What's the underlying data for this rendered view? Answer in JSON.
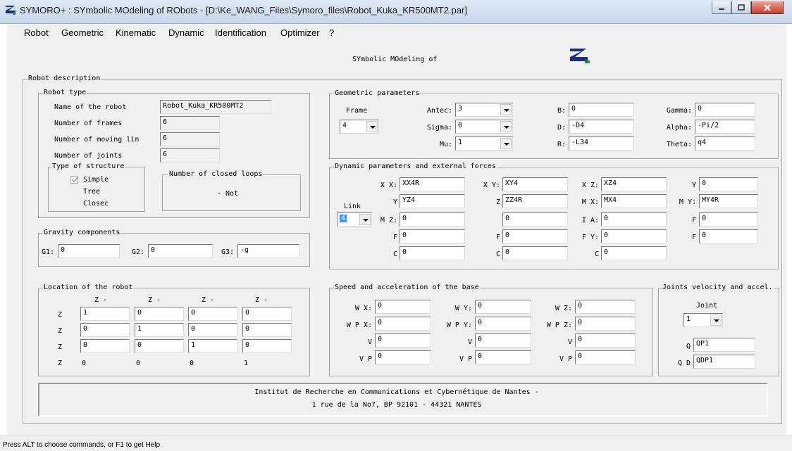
{
  "window": {
    "title": "SYMORO+ : SYmbolic MOdeling of RObots - [D:\\Ke_WANG_Files\\Symoro_files\\Robot_Kuka_KR500MT2.par]",
    "controls": {
      "minimize": "minimize-icon",
      "maximize": "maximize-icon",
      "close": "close-icon"
    }
  },
  "menu": [
    "Robot",
    "Geometric",
    "Kinematic",
    "Dynamic",
    "Identification",
    "Optimizer",
    "?"
  ],
  "header": {
    "subtitle": "SYmbolic MOdeling of",
    "logo": "robot-logo-icon"
  },
  "robot_description": {
    "title": "Robot description",
    "robot_type": {
      "title": "Robot type",
      "name_label": "Name of the robot",
      "name_value": "Robot_Kuka_KR500MT2",
      "frames_label": "Number of frames",
      "frames_value": "6",
      "moving_label": "Number of moving lin",
      "moving_value": "6",
      "joints_label": "Number of joints",
      "joints_value": "6",
      "structure": {
        "title": "Type of structure",
        "options": [
          "Simple",
          "Tree",
          "Closec"
        ],
        "selected": "Simple"
      },
      "closed_loops": {
        "title": "Number of closed loops",
        "value": "- Not"
      }
    },
    "gravity": {
      "title": "Gravity components",
      "g1_label": "G1:",
      "g1_value": "0",
      "g2_label": "G2:",
      "g2_value": "0",
      "g3_label": "G3:",
      "g3_value": "-g"
    },
    "location": {
      "title": "Location of the robot",
      "col_headers": [
        "Z -",
        "Z -",
        "Z -",
        "Z -"
      ],
      "row_labels": [
        "Z",
        "Z",
        "Z",
        "Z"
      ],
      "rows": [
        [
          "1",
          "0",
          "0",
          "0"
        ],
        [
          "0",
          "1",
          "0",
          "0"
        ],
        [
          "0",
          "0",
          "1",
          "0"
        ],
        [
          "0",
          "0",
          "0",
          "1"
        ]
      ]
    }
  },
  "geometric": {
    "title": "Geometric parameters",
    "frame_label": "Frame",
    "frame_value": "4",
    "antec_label": "Antec:",
    "antec_value": "3",
    "sigma_label": "Sigma:",
    "sigma_value": "0",
    "mu_label": "Mu:",
    "mu_value": "1",
    "b_label": "B:",
    "b_value": "0",
    "d_label": "D:",
    "d_value": "-D4",
    "r_label": "R:",
    "r_value": "-L34",
    "gamma_label": "Gamma:",
    "gamma_value": "0",
    "alpha_label": "Alpha:",
    "alpha_value": "-Pi/2",
    "theta_label": "Theta:",
    "theta_value": "q4"
  },
  "dynamic": {
    "title": "Dynamic parameters and external forces",
    "link_label": "Link",
    "link_value": "4",
    "labels": {
      "xx": "X X:",
      "xy": "X Y:",
      "xz": "X Z:",
      "y": "Y",
      "yy": "Y",
      "yz": "Z",
      "mx": "M X:",
      "my": "M Y:",
      "mz": "M Z:",
      "ia": "I A:",
      "f": "F",
      "fx": "F",
      "fy": "F",
      "fy2": "F Y:",
      "fz": "F",
      "c1": "C",
      "c2": "C",
      "c3": "C"
    },
    "values": {
      "xx": "XX4R",
      "xy": "XY4",
      "xz": "XZ4",
      "y": "0",
      "yy": "YZ4",
      "yz": "ZZ4R",
      "mx": "MX4",
      "my": "MY4R",
      "mz": "0",
      "m2": "0",
      "ia": "0",
      "f": "0",
      "fx": "0",
      "fx2": "0",
      "fy": "0",
      "fz": "0",
      "c1": "0",
      "c2": "0",
      "c3": "0"
    }
  },
  "speed": {
    "title": "Speed and acceleration of the base",
    "labels": [
      "W X:",
      "W Y:",
      "W Z:",
      "W P X:",
      "W P Y:",
      "W P Z:",
      "V",
      "V",
      "V",
      "V P",
      "V P",
      "V P"
    ],
    "values": [
      "0",
      "0",
      "0",
      "0",
      "0",
      "0",
      "0",
      "0",
      "0",
      "0",
      "0",
      "0"
    ]
  },
  "joints": {
    "title": "Joints velocity and accel.",
    "joint_label": "Joint",
    "joint_value": "1",
    "q_label": "Q",
    "q_value": "QP1",
    "qd_label": "Q D",
    "qd_value": "QDP1"
  },
  "footer": {
    "line1": "Institut de Recherche en Communications et Cybernétique de Nantes   -",
    "line2": "1 rue de la No7, BP 92101   -   44321 NANTES"
  },
  "statusbar": {
    "text": "Press ALT to choose commands, or F1 to get Help"
  }
}
